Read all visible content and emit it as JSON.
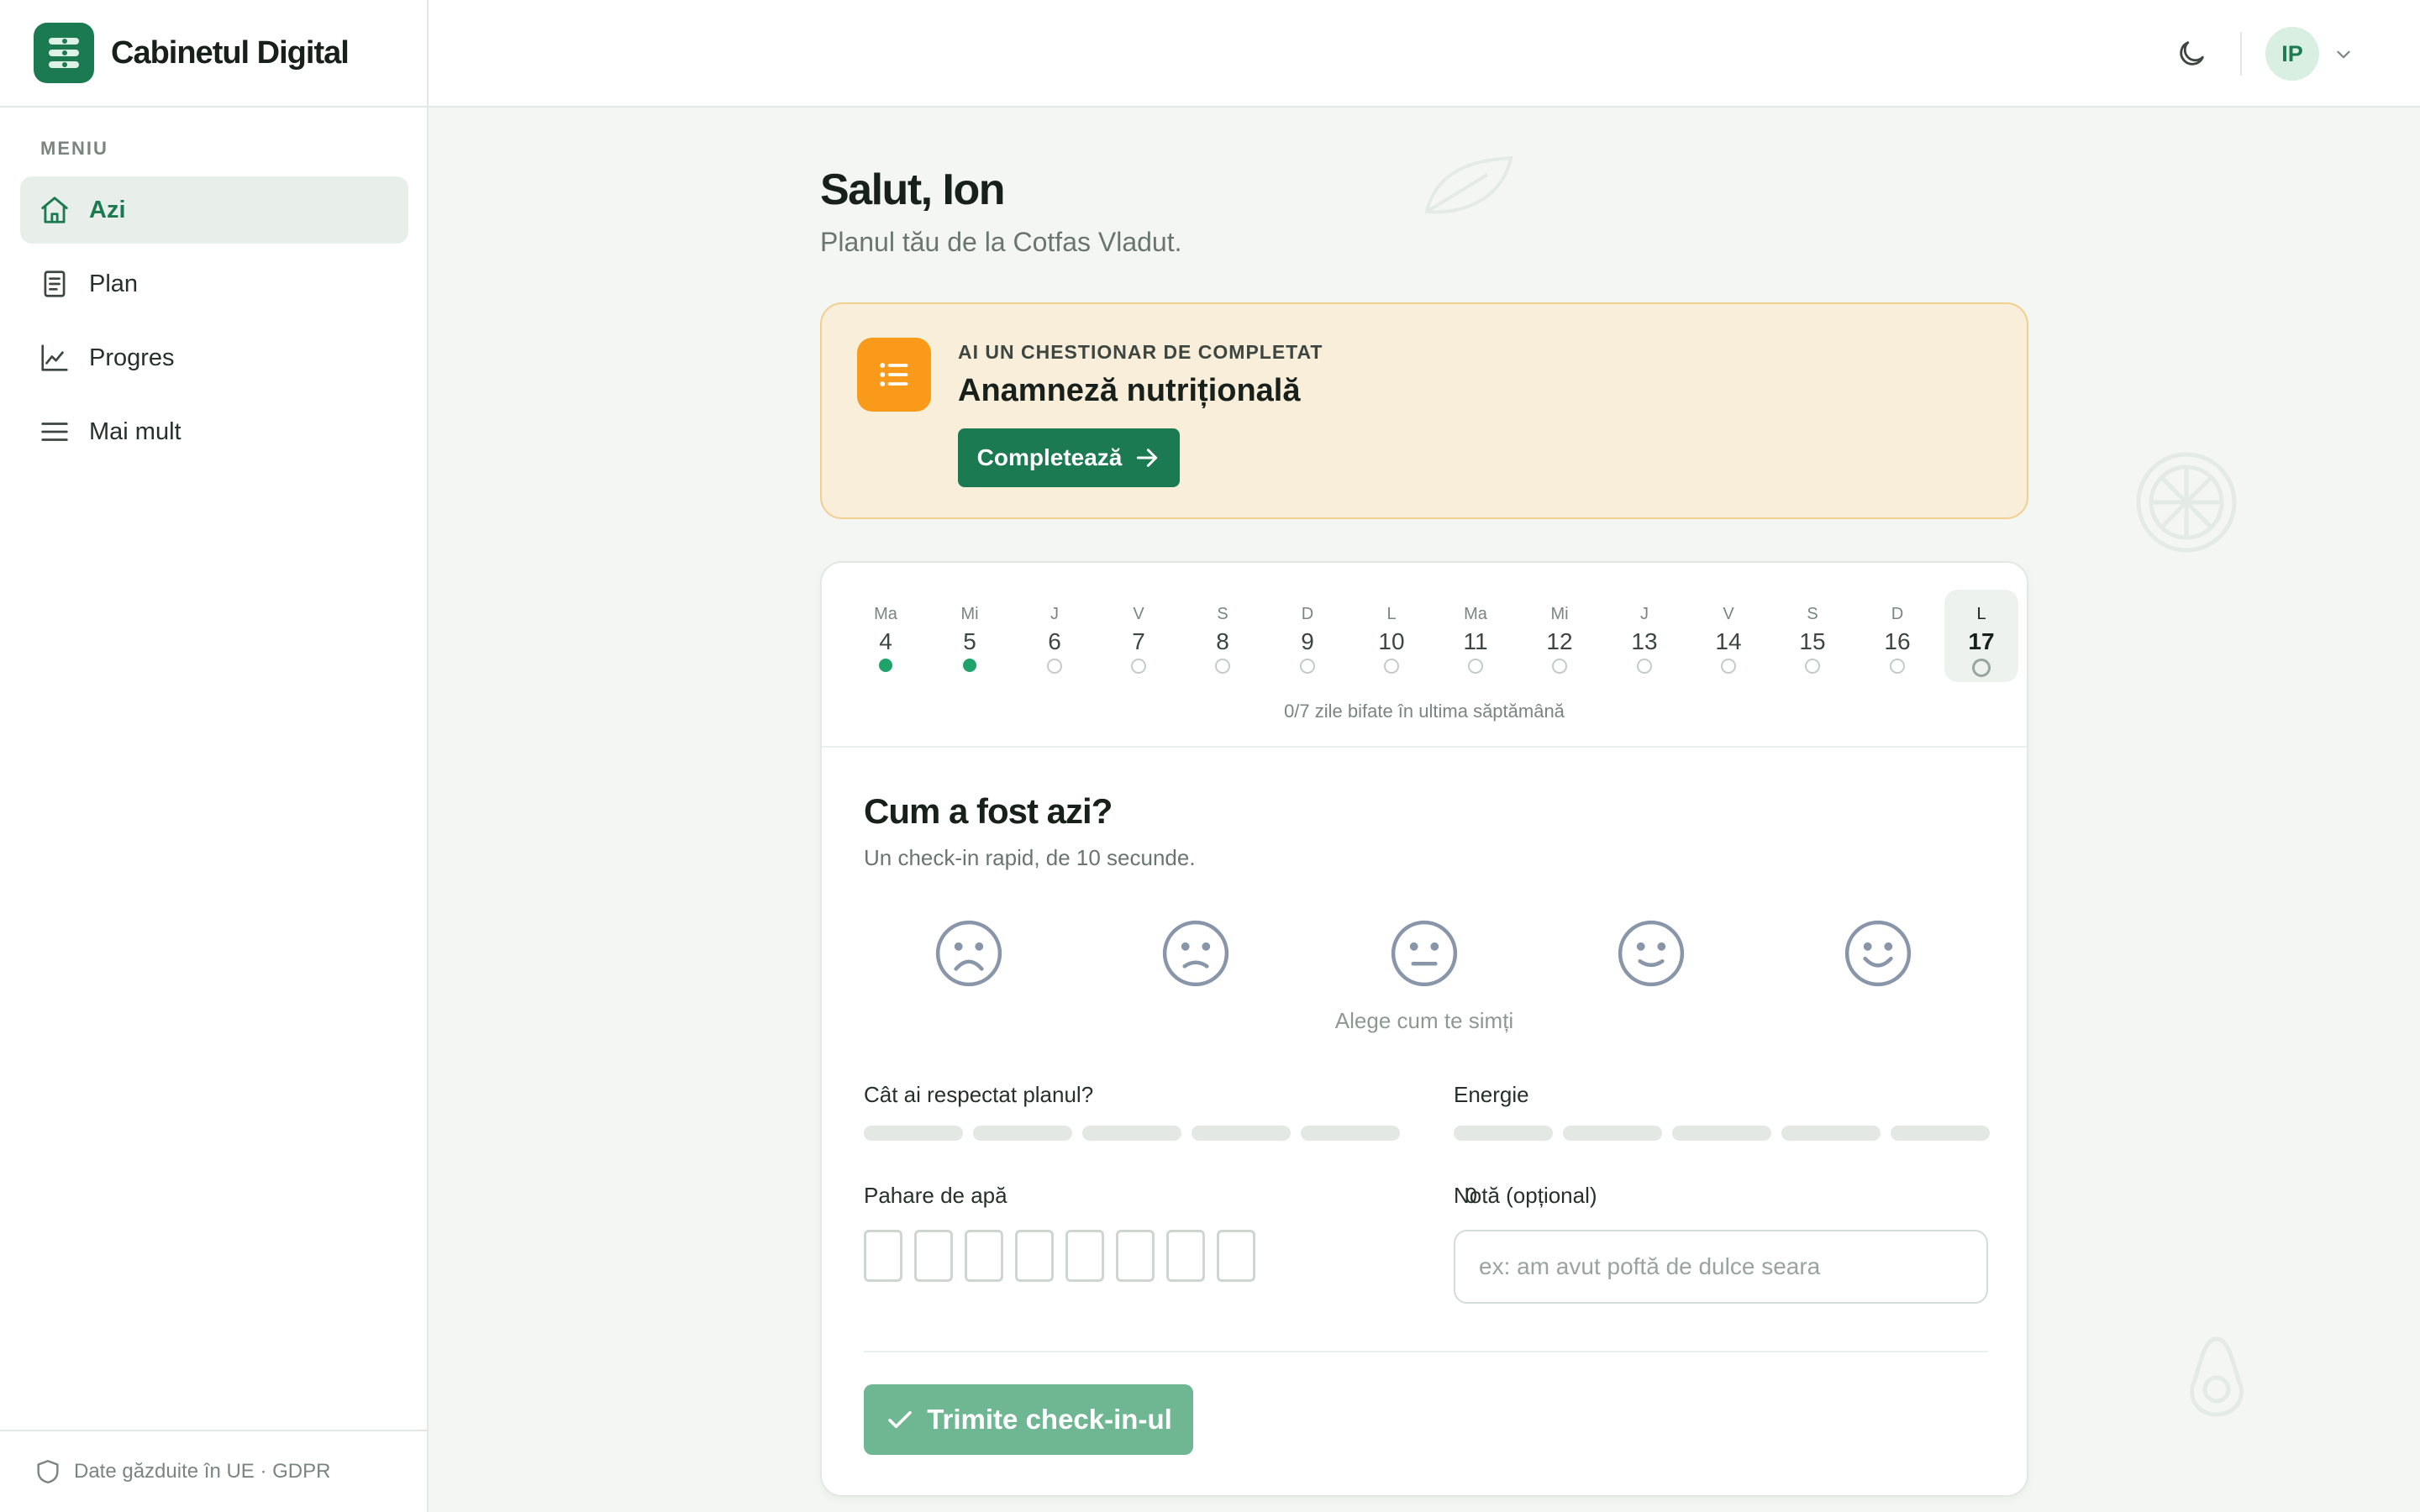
{
  "brand": {
    "name": "Cabinetul Digital"
  },
  "sidebar": {
    "menu_title": "MENIU",
    "items": [
      {
        "label": "Azi",
        "icon": "home-icon",
        "active": true
      },
      {
        "label": "Plan",
        "icon": "document-icon",
        "active": false
      },
      {
        "label": "Progres",
        "icon": "chart-icon",
        "active": false
      },
      {
        "label": "Mai mult",
        "icon": "menu-icon",
        "active": false
      }
    ],
    "footer": "Date găzduite în UE · GDPR"
  },
  "topbar": {
    "theme_toggle_icon": "moon-icon",
    "avatar_initials": "IP",
    "dropdown_icon": "chevron-down-icon"
  },
  "main": {
    "greeting": "Salut, Ion",
    "subtitle": "Planul tău de la Cotfas Vladut."
  },
  "banner": {
    "icon": "list-icon",
    "kicker": "AI UN CHESTIONAR DE COMPLETAT",
    "title": "Anamneză nutrițională",
    "button_label": "Completează"
  },
  "days": [
    {
      "name": "Ma",
      "num": "4",
      "done": true
    },
    {
      "name": "Mi",
      "num": "5",
      "done": true
    },
    {
      "name": "J",
      "num": "6",
      "done": false
    },
    {
      "name": "V",
      "num": "7",
      "done": false
    },
    {
      "name": "S",
      "num": "8",
      "done": false
    },
    {
      "name": "D",
      "num": "9",
      "done": false
    },
    {
      "name": "L",
      "num": "10",
      "done": false
    },
    {
      "name": "Ma",
      "num": "11",
      "done": false
    },
    {
      "name": "Mi",
      "num": "12",
      "done": false
    },
    {
      "name": "J",
      "num": "13",
      "done": false
    },
    {
      "name": "V",
      "num": "14",
      "done": false
    },
    {
      "name": "S",
      "num": "15",
      "done": false
    },
    {
      "name": "D",
      "num": "16",
      "done": false
    },
    {
      "name": "L",
      "num": "17",
      "done": false,
      "today": true
    }
  ],
  "week_stat": "0/7 zile bifate în ultima săptămână",
  "checkin": {
    "title": "Cum a fost azi?",
    "subtitle": "Un check-in rapid, de 10 secunde.",
    "moods": [
      "very-sad-face-icon",
      "sad-face-icon",
      "neutral-face-icon",
      "happy-face-icon",
      "very-happy-face-icon"
    ],
    "mood_hint": "Alege cum te simți",
    "plan_label": "Cât ai respectat planul?",
    "plan_value": 0,
    "plan_max": 5,
    "energy_label": "Energie",
    "energy_value": 0,
    "energy_max": 5,
    "water_label": "Pahare de apă",
    "water_count": "0",
    "water_max": 8,
    "note_label": "Notă (opțional)",
    "note_placeholder": "ex: am avut poftă de dulce seara",
    "note_value": "",
    "submit_label": "Trimite check-in-ul"
  },
  "colors": {
    "brand": "#1c7a52",
    "done_dot": "#1fa36b",
    "banner_bg": "#f8eed9",
    "banner_icon": "#f99a1b",
    "submit_disabled": "#6fb693"
  }
}
